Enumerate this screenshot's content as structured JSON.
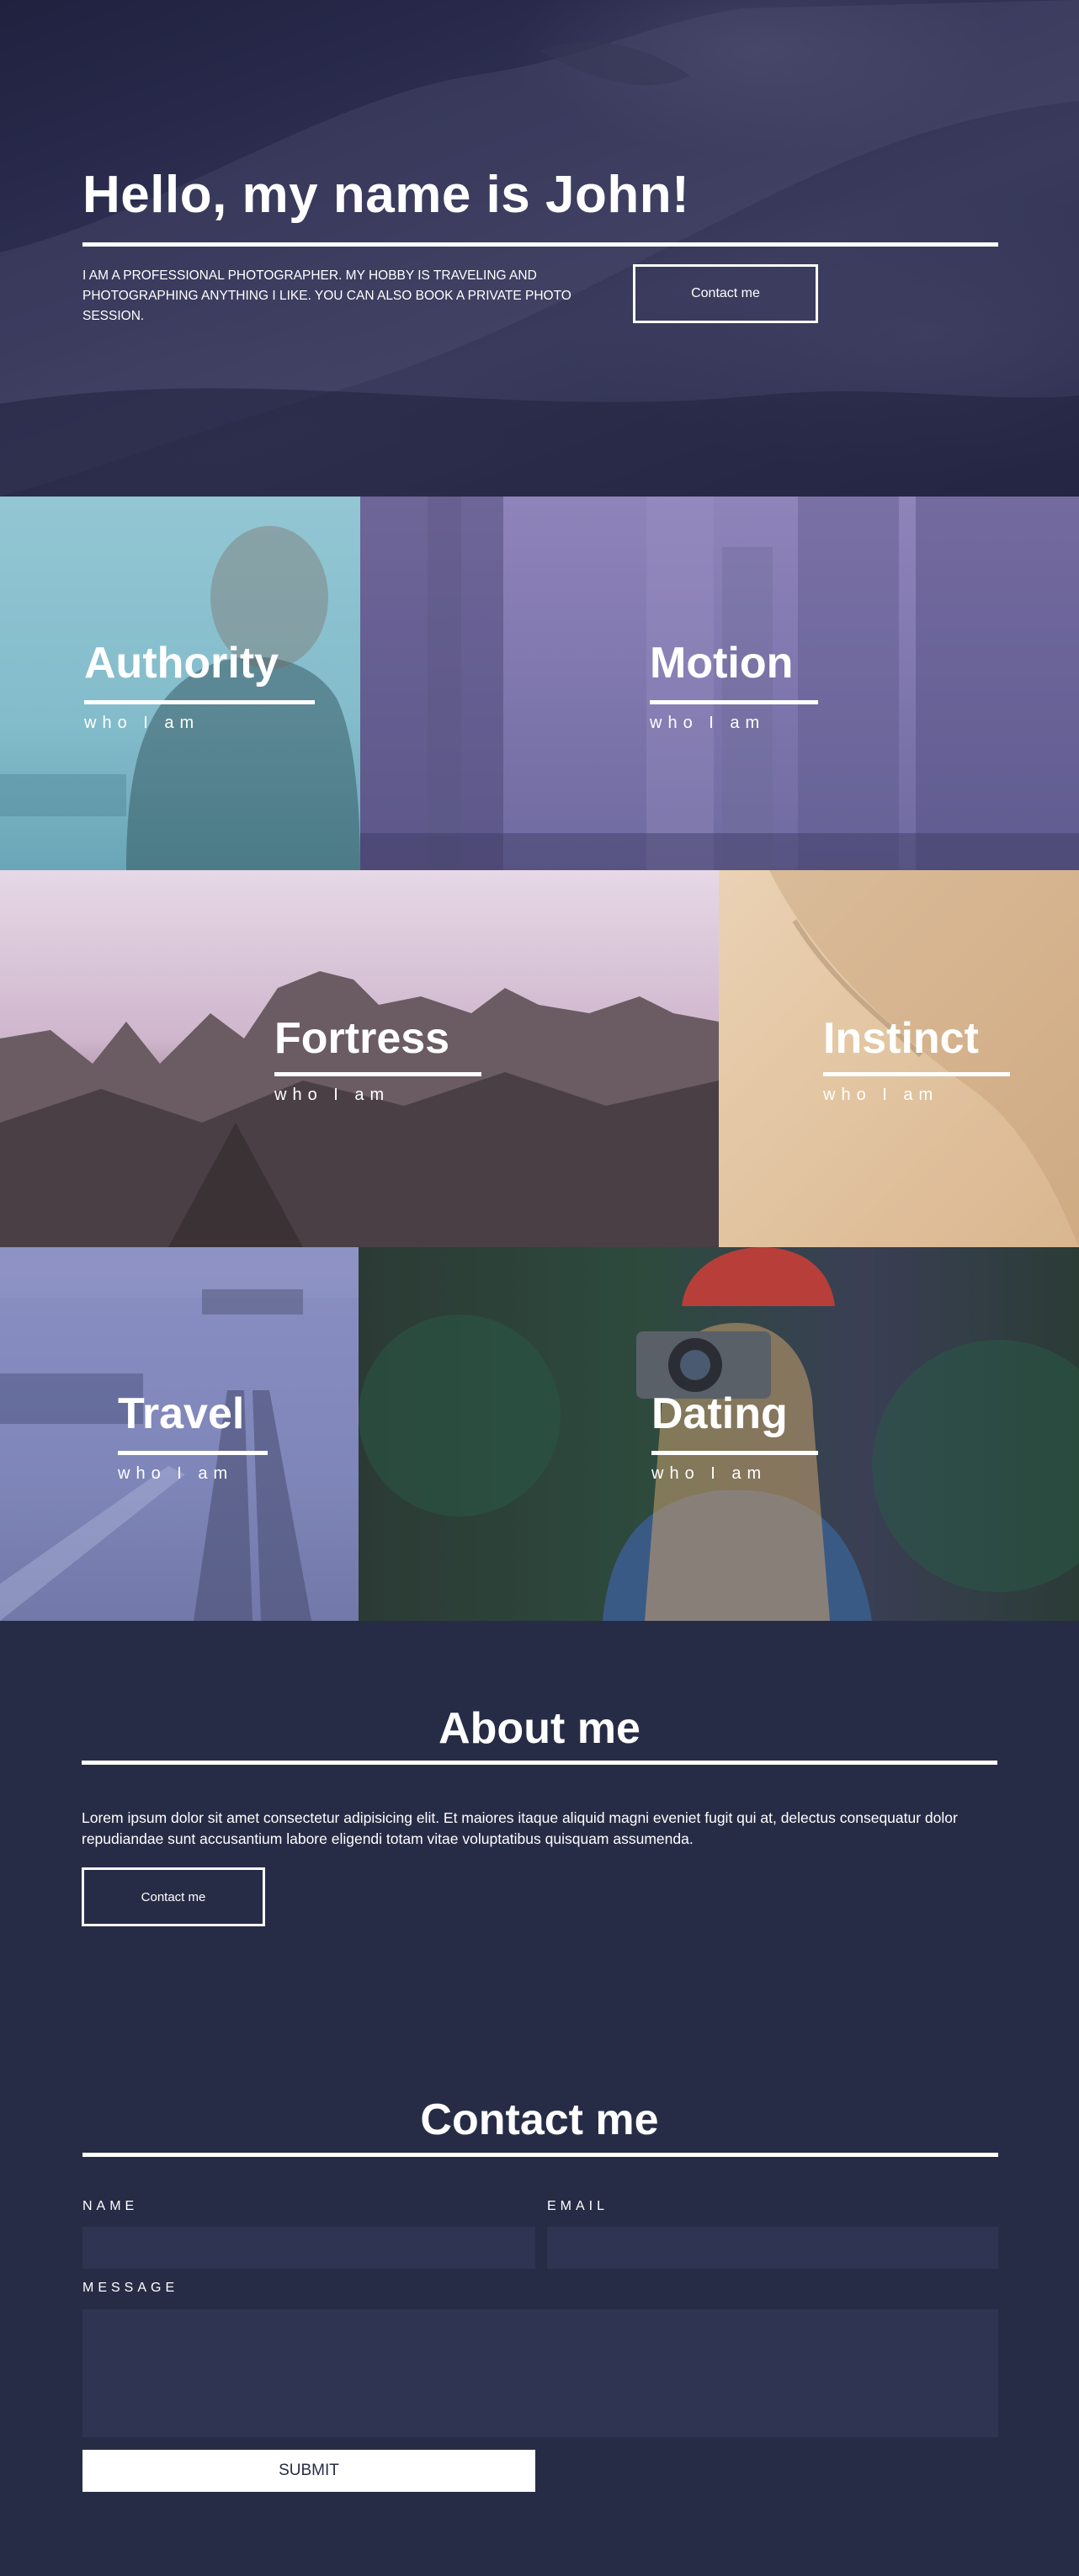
{
  "hero": {
    "title": "Hello, my name is John!",
    "text": "I AM A PROFESSIONAL PHOTOGRAPHER. MY HOBBY IS TRAVELING AND PHOTOGRAPHING ANYTHING I LIKE. YOU CAN ALSO BOOK A PRIVATE PHOTO SESSION.",
    "button_label": "Contact me"
  },
  "tiles": [
    {
      "label": "Authority",
      "sub": "who I am"
    },
    {
      "label": "Motion",
      "sub": "who I am"
    },
    {
      "label": "Fortress",
      "sub": "who I am"
    },
    {
      "label": "Instinct",
      "sub": "who I am"
    },
    {
      "label": "Travel",
      "sub": "who I am"
    },
    {
      "label": "Dating",
      "sub": "who I am"
    }
  ],
  "about": {
    "title": "About me",
    "text": "Lorem ipsum dolor sit amet consectetur adipisicing elit. Et maiores itaque aliquid magni eveniet fugit qui at, delectus consequatur dolor repudiandae sunt accusantium labore eligendi totam vitae voluptatibus quisquam assumenda.",
    "button_label": "Contact me"
  },
  "contact": {
    "title": "Contact me",
    "name_label": "NAME",
    "email_label": "EMAIL",
    "message_label": "MESSAGE",
    "name_value": "",
    "email_value": "",
    "message_value": "",
    "submit_label": "SUBMIT"
  },
  "colors": {
    "background": "#272c46",
    "field": "#2f3452",
    "accent": "#ffffff"
  }
}
